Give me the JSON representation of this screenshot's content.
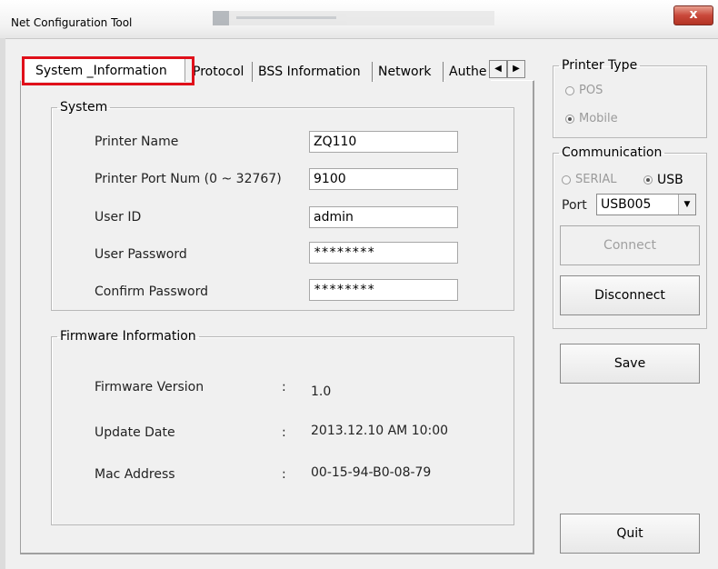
{
  "window": {
    "title": "Net Configuration Tool",
    "close_glyph": "x"
  },
  "tabs": [
    {
      "label": "System _Information"
    },
    {
      "label": "Protocol"
    },
    {
      "label": "BSS Information"
    },
    {
      "label": "Network"
    },
    {
      "label": "Authe"
    }
  ],
  "tab_scroll": {
    "left": "◀",
    "right": "▶"
  },
  "system": {
    "legend": "System",
    "printer_name_label": "Printer Name",
    "printer_name_value": "ZQ110",
    "port_label": "Printer Port Num (0 ~ 32767)",
    "port_value": "9100",
    "user_id_label": "User ID",
    "user_id_value": "admin",
    "password_label": "User Password",
    "password_value": "********",
    "confirm_label": "Confirm Password",
    "confirm_value": "********"
  },
  "firmware": {
    "legend": "Firmware Information",
    "version_label": "Firmware Version",
    "version_value": "1.0",
    "date_label": "Update Date",
    "date_value": "2013.12.10 AM 10:00",
    "mac_label": "Mac Address",
    "mac_value": "00-15-94-B0-08-79",
    "colon": ":"
  },
  "printer_type": {
    "legend": "Printer Type",
    "options": [
      "POS",
      "Mobile"
    ],
    "selected": "Mobile"
  },
  "communication": {
    "legend": "Communication",
    "options": [
      "SERIAL",
      "USB"
    ],
    "selected": "USB",
    "port_label": "Port",
    "port_value": "USB005",
    "dropdown_glyph": "▼"
  },
  "buttons": {
    "connect": "Connect",
    "disconnect": "Disconnect",
    "save": "Save",
    "quit": "Quit"
  },
  "colors": {
    "highlight": "#e0101a"
  }
}
